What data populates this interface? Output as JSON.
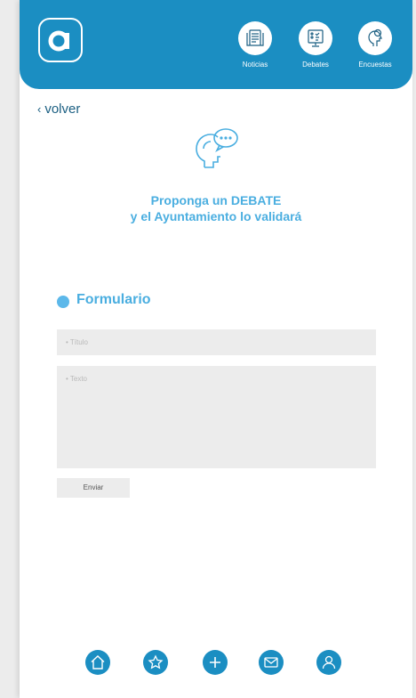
{
  "header": {
    "logo_letter": "a",
    "nav": [
      {
        "label": "Noticias",
        "icon": "newspaper-icon"
      },
      {
        "label": "Debates",
        "icon": "debate-board-icon"
      },
      {
        "label": "Encuestas",
        "icon": "thinking-head-icon"
      }
    ]
  },
  "back": {
    "label": "volver"
  },
  "hero": {
    "icon": "talking-head-icon",
    "line1": "Proponga un DEBATE",
    "line2": "y el Ayuntamiento lo validará"
  },
  "form": {
    "section_title": "Formulario",
    "title_placeholder": "• Título",
    "text_placeholder": "• Texto",
    "submit_label": "Enviar"
  },
  "tabbar": {
    "items": [
      "home-icon",
      "star-icon",
      "plus-icon",
      "mail-icon",
      "user-icon"
    ]
  },
  "colors": {
    "primary": "#1b8ec2",
    "accent": "#4aaee0",
    "field_bg": "#ececec"
  }
}
